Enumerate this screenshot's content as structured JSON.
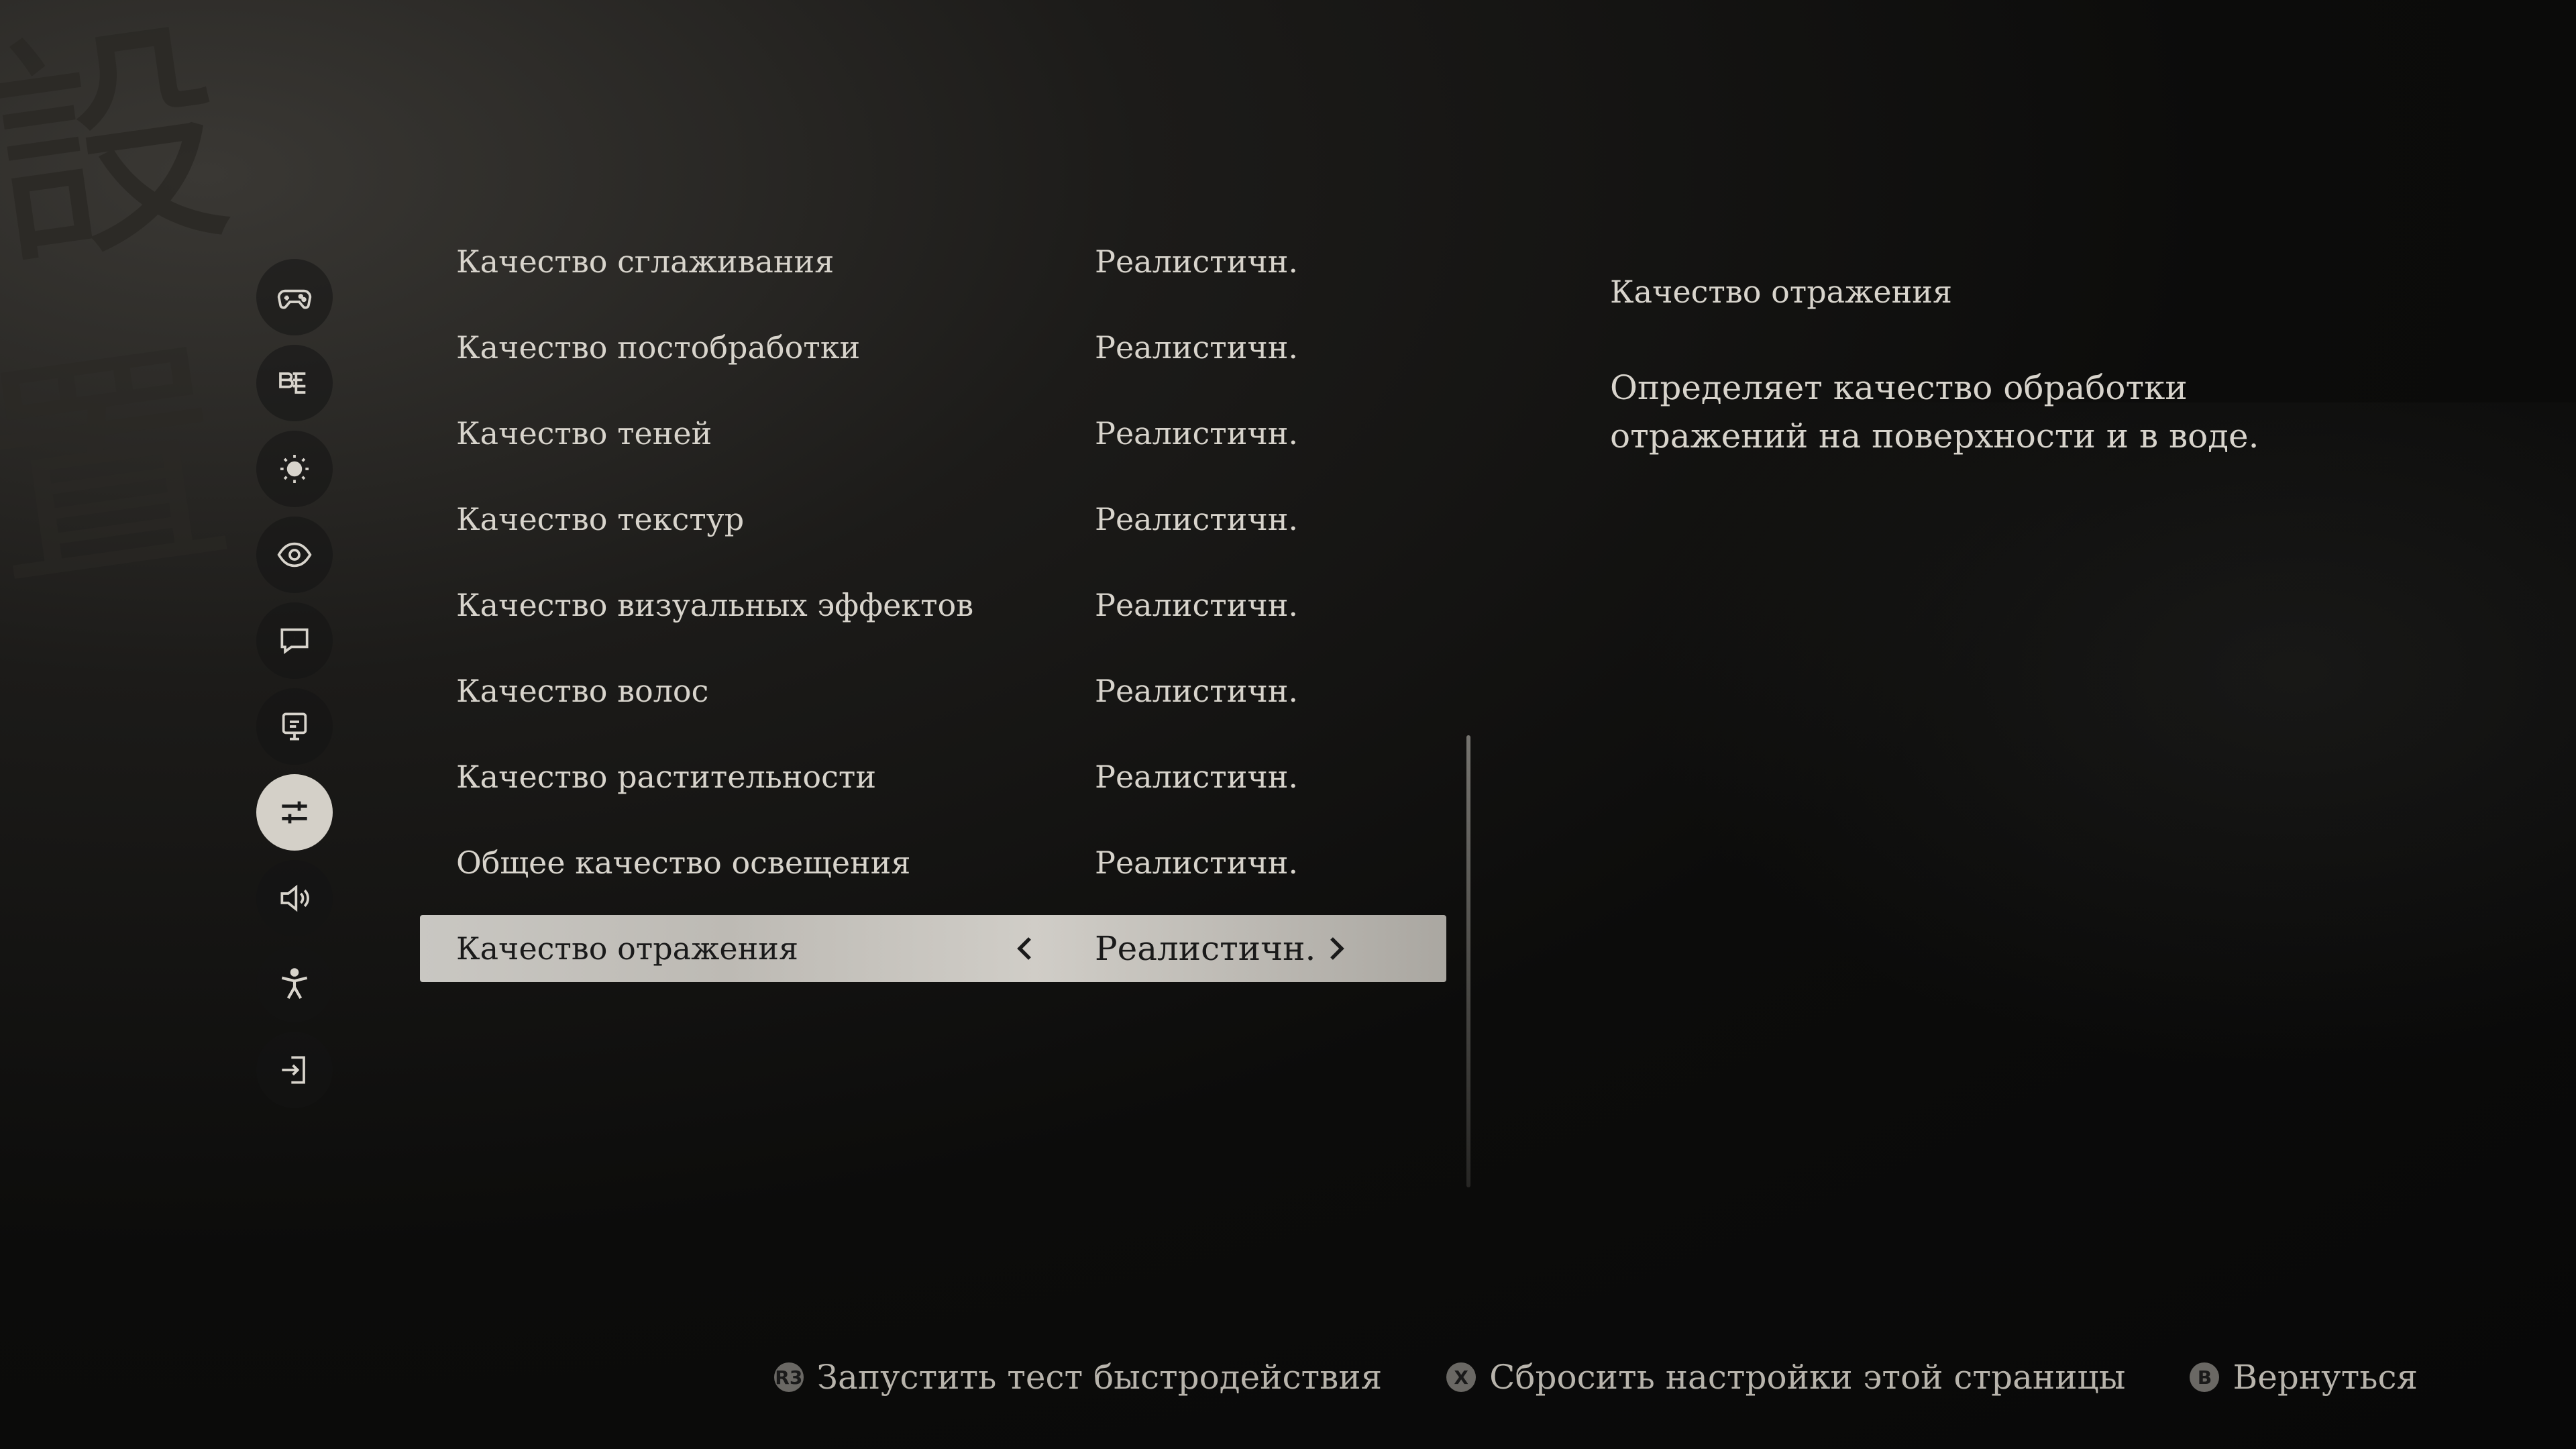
{
  "background": {
    "glyph_top": "設",
    "glyph_bottom": "置"
  },
  "sidebar": {
    "items": [
      {
        "icon": "gamepad-icon",
        "active": false
      },
      {
        "icon": "language-icon",
        "active": false
      },
      {
        "icon": "brightness-icon",
        "active": false
      },
      {
        "icon": "eye-icon",
        "active": false
      },
      {
        "icon": "subtitles-icon",
        "active": false
      },
      {
        "icon": "display-icon",
        "active": false
      },
      {
        "icon": "graphics-sliders-icon",
        "active": true
      },
      {
        "icon": "audio-icon",
        "active": false
      },
      {
        "icon": "accessibility-icon",
        "active": false
      },
      {
        "icon": "account-icon",
        "active": false
      }
    ]
  },
  "settings": [
    {
      "label": "Качество сглаживания",
      "value": "Реалистичн."
    },
    {
      "label": "Качество постобработки",
      "value": "Реалистичн."
    },
    {
      "label": "Качество теней",
      "value": "Реалистичн."
    },
    {
      "label": "Качество текстур",
      "value": "Реалистичн."
    },
    {
      "label": "Качество визуальных эффектов",
      "value": "Реалистичн."
    },
    {
      "label": "Качество волос",
      "value": "Реалистичн."
    },
    {
      "label": "Качество растительности",
      "value": "Реалистичн."
    },
    {
      "label": "Общее качество освещения",
      "value": "Реалистичн."
    },
    {
      "label": "Качество отражения",
      "value": "Реалистичн.",
      "selected": true
    }
  ],
  "description": {
    "title": "Качество отражения",
    "body": "Определяет качество обработки отражений на поверхности и в воде."
  },
  "footer": {
    "benchmark": {
      "button": "R3",
      "label": "Запустить тест быстродействия"
    },
    "reset": {
      "button": "X",
      "label": "Сбросить настройки этой страницы"
    },
    "back": {
      "button": "B",
      "label": "Вернуться"
    }
  },
  "colors": {
    "selected_row": "#c9c7c2",
    "text": "#d8d4cc",
    "background": "#0c0c0b"
  }
}
